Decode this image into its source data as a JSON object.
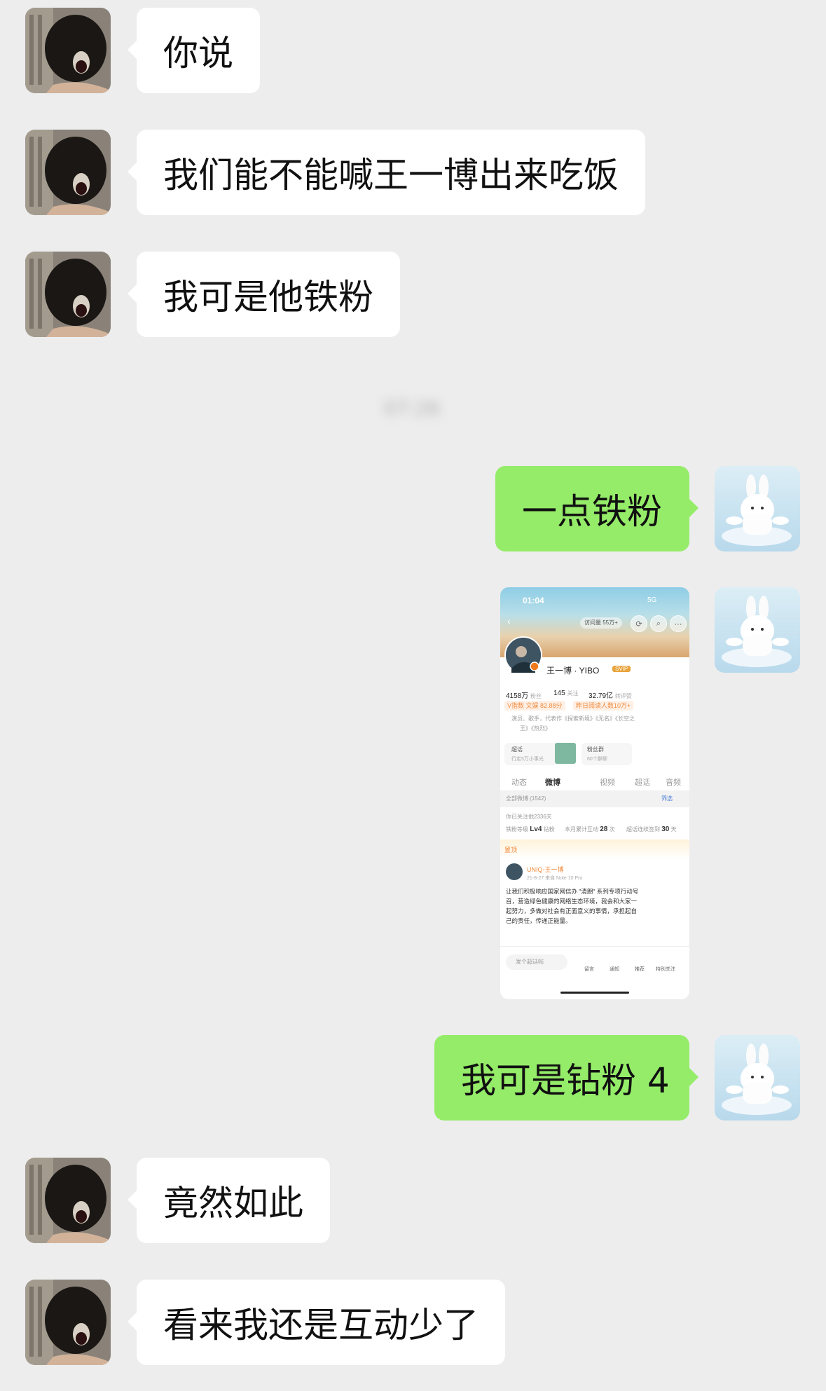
{
  "messages": [
    {
      "side": "in",
      "text": "你说"
    },
    {
      "side": "in",
      "text": "我们能不能喊王一博出来吃饭"
    },
    {
      "side": "in",
      "text": "我可是他铁粉"
    },
    {
      "side": "out",
      "text": "一点铁粉"
    },
    {
      "side": "out",
      "type": "image"
    },
    {
      "side": "out",
      "text": "我可是钻粉 4"
    },
    {
      "side": "in",
      "text": "竟然如此"
    },
    {
      "side": "in",
      "text": "看来我还是互动少了"
    }
  ],
  "timestamp": "07:26",
  "shot": {
    "time": "01:04",
    "network": "5G",
    "visits": "访问量 55万+",
    "name": "王一博 · YIBO",
    "vip_badge": "SVIP",
    "followers": "4158万",
    "followers_label": "粉丝",
    "following": "145",
    "following_label": "关注",
    "reposts": "32.79亿",
    "reposts_label": "转评赞",
    "tag1": "V指数 文娱 82.88分",
    "tag2": "昨日阅读人数10万+",
    "bio_line1": "演员、歌手，代表作《探索新境》《无名》《长空之",
    "bio_line2": "王》《热烈》",
    "card1_title": "超话",
    "card1_sub": "行走5万小事光",
    "card2_title": "粉丝群",
    "card2_sub": "60个群聊",
    "tabs": [
      "动态",
      "微博",
      "视频",
      "超话",
      "音频"
    ],
    "all_posts": "全部微博 (1542)",
    "filter": "筛选",
    "follow_days": "你已关注他2336天",
    "fan_level_label": "铁粉等级",
    "fan_level": "Lv4",
    "fan_level_suffix": "钻粉",
    "monthly_label": "本月累计互动",
    "monthly_value": "28",
    "monthly_unit": "次",
    "streak_label": "超话连续签到",
    "streak_value": "30",
    "streak_unit": "天",
    "pinned": "置顶",
    "post_author": "UNIQ-王一博",
    "post_meta": "21-8-27  来自 Note 10 Pro",
    "post_lines": [
      "让我们积极响应国家网信办 \"清朗\" 系列专项行动号",
      "召，营造绿色健康的网络生态环境，我会和大家一",
      "起努力，多做对社会有正面意义的事情，承担起自",
      "己的责任，传递正能量。"
    ],
    "compose": "发个超话帖",
    "bottom_tabs": [
      "留言",
      "通知",
      "推荐",
      "特别关注"
    ]
  }
}
